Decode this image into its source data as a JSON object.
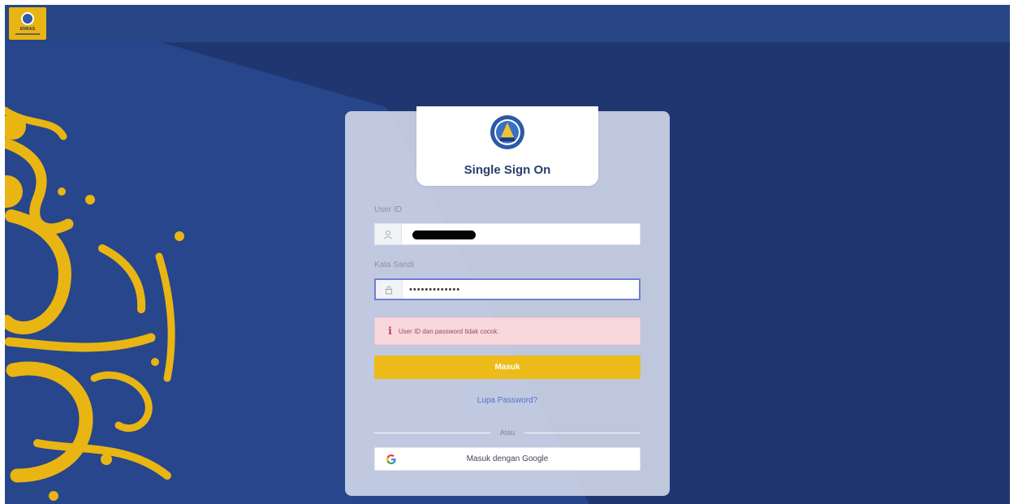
{
  "brand": {
    "logo_text": "ENRAS"
  },
  "login": {
    "title": "Single Sign On",
    "user_id_label": "User ID",
    "password_label": "Kata Sandi",
    "password_value": "•••••••••••••",
    "error_message": "User ID dan password tidak cocok.",
    "submit_label": "Masuk",
    "forgot_label": "Lupa Password?",
    "divider_label": "Atau",
    "google_label": "Masuk dengan Google"
  },
  "colors": {
    "background": "#203a73",
    "accent": "#edbb1a",
    "link": "#5571c9",
    "error_bg": "#f8d8dd"
  },
  "icons": {
    "user": "user-icon",
    "lock": "lock-icon",
    "info": "info-icon",
    "google": "google-icon"
  }
}
